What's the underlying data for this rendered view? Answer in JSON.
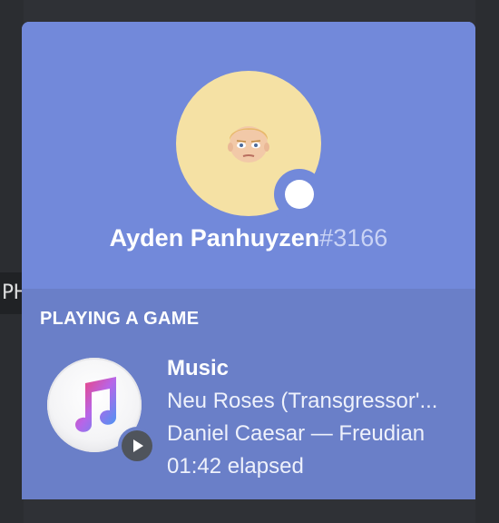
{
  "background": {
    "left_chip_text": "PH"
  },
  "profile": {
    "username": "Ayden Panhuyzen",
    "discriminator": "#3166",
    "status": "online"
  },
  "activity": {
    "header": "PLAYING A GAME",
    "app_name": "Music",
    "details": "Neu Roses (Transgressor'...",
    "state": "Daniel Caesar — Freudian",
    "elapsed": "01:42 elapsed",
    "app_icon": "itunes-music-icon",
    "badge_icon": "play-icon"
  },
  "colors": {
    "accent": "#7289da",
    "activity_bg": "#6a7fc8",
    "page_bg": "#2f3136"
  }
}
